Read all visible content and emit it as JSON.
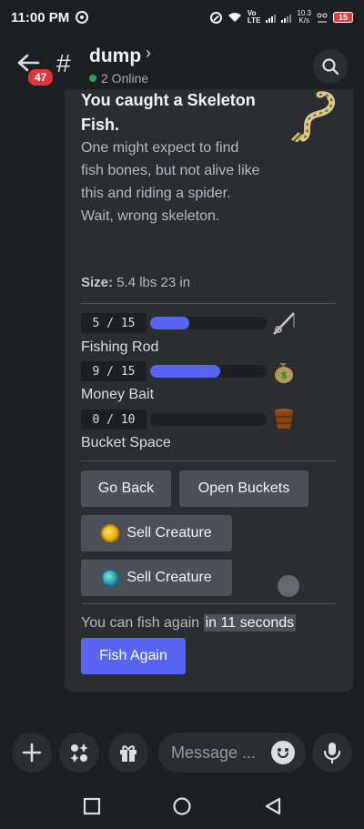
{
  "status_bar": {
    "time": "11:00 PM",
    "network": "Vo\nLTE",
    "speed_top": "10.3",
    "speed_bottom": "K/s",
    "battery": "15"
  },
  "header": {
    "unread_count": "47",
    "channel_name": "dump",
    "online_text": "2 Online"
  },
  "embed": {
    "title": "You caught a Skeleton Fish.",
    "description": "One might expect to find fish bones, but not alive like this and riding a spider. Wait, wrong skeleton.",
    "size_label": "Size:",
    "size_value": "5.4 lbs 23 in",
    "stats": [
      {
        "counter": "5 / 15",
        "label": "Fishing Rod",
        "fraction": 0.3333,
        "icon": "fishing-rod-icon"
      },
      {
        "counter": "9 / 15",
        "label": "Money Bait",
        "fraction": 0.6,
        "icon": "money-bag-icon"
      },
      {
        "counter": "0 / 10",
        "label": "Bucket Space",
        "fraction": 0,
        "icon": "bucket-icon"
      }
    ],
    "buttons": {
      "go_back": "Go Back",
      "open_buckets": "Open Buckets",
      "sell_gold": "Sell Creature",
      "sell_blue": "Sell Creature"
    },
    "cooldown_prefix": "You can fish again ",
    "cooldown_highlight": "in 11 seconds",
    "fish_again": "Fish Again"
  },
  "composer": {
    "placeholder": "Message ..."
  },
  "colors": {
    "accent": "#5865f2",
    "background": "#1e1f22",
    "card": "#2b2d31",
    "unread_badge": "#e0353b",
    "online": "#23a55a"
  }
}
